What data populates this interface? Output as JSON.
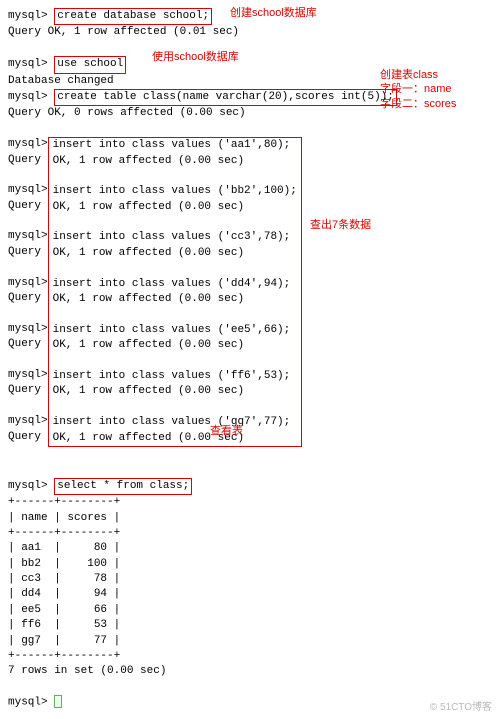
{
  "notes": {
    "create_db": "创建school数据库",
    "use_db": "使用school数据库",
    "create_table": "创建表class",
    "field1": "字段一：name",
    "field2": "字段二：scores",
    "inserts": "查出7条数据",
    "select": "查看表"
  },
  "cmds": {
    "create_db": "create database school;",
    "use_db": "use school",
    "create_table": "create table class(name varchar(20),scores int(5));",
    "select": "select * from class;"
  },
  "resp": {
    "ok1": "Query OK, 1 row affected (0.01 sec)",
    "dbchanged": "Database changed",
    "ok0": "Query OK, 0 rows affected (0.00 sec)",
    "ok1b": "Query OK, 1 row affected (0.00 sec)",
    "rowsinset": "7 rows in set (0.00 sec)"
  },
  "inserts": [
    "insert into class values ('aa1',80);",
    "insert into class values ('bb2',100);",
    "insert into class values ('cc3',78);",
    "insert into class values ('dd4',94);",
    "insert into class values ('ee5',66);",
    "insert into class values ('ff6',53);",
    "insert into class values ('gg7',77);"
  ],
  "table": {
    "border": "+------+--------+",
    "header": "| name | scores |",
    "rows": [
      "| aa1  |     80 |",
      "| bb2  |    100 |",
      "| cc3  |     78 |",
      "| dd4  |     94 |",
      "| ee5  |     66 |",
      "| ff6  |     53 |",
      "| gg7  |     77 |"
    ]
  },
  "prompt": "mysql> ",
  "watermark": "© 51CTO博客"
}
